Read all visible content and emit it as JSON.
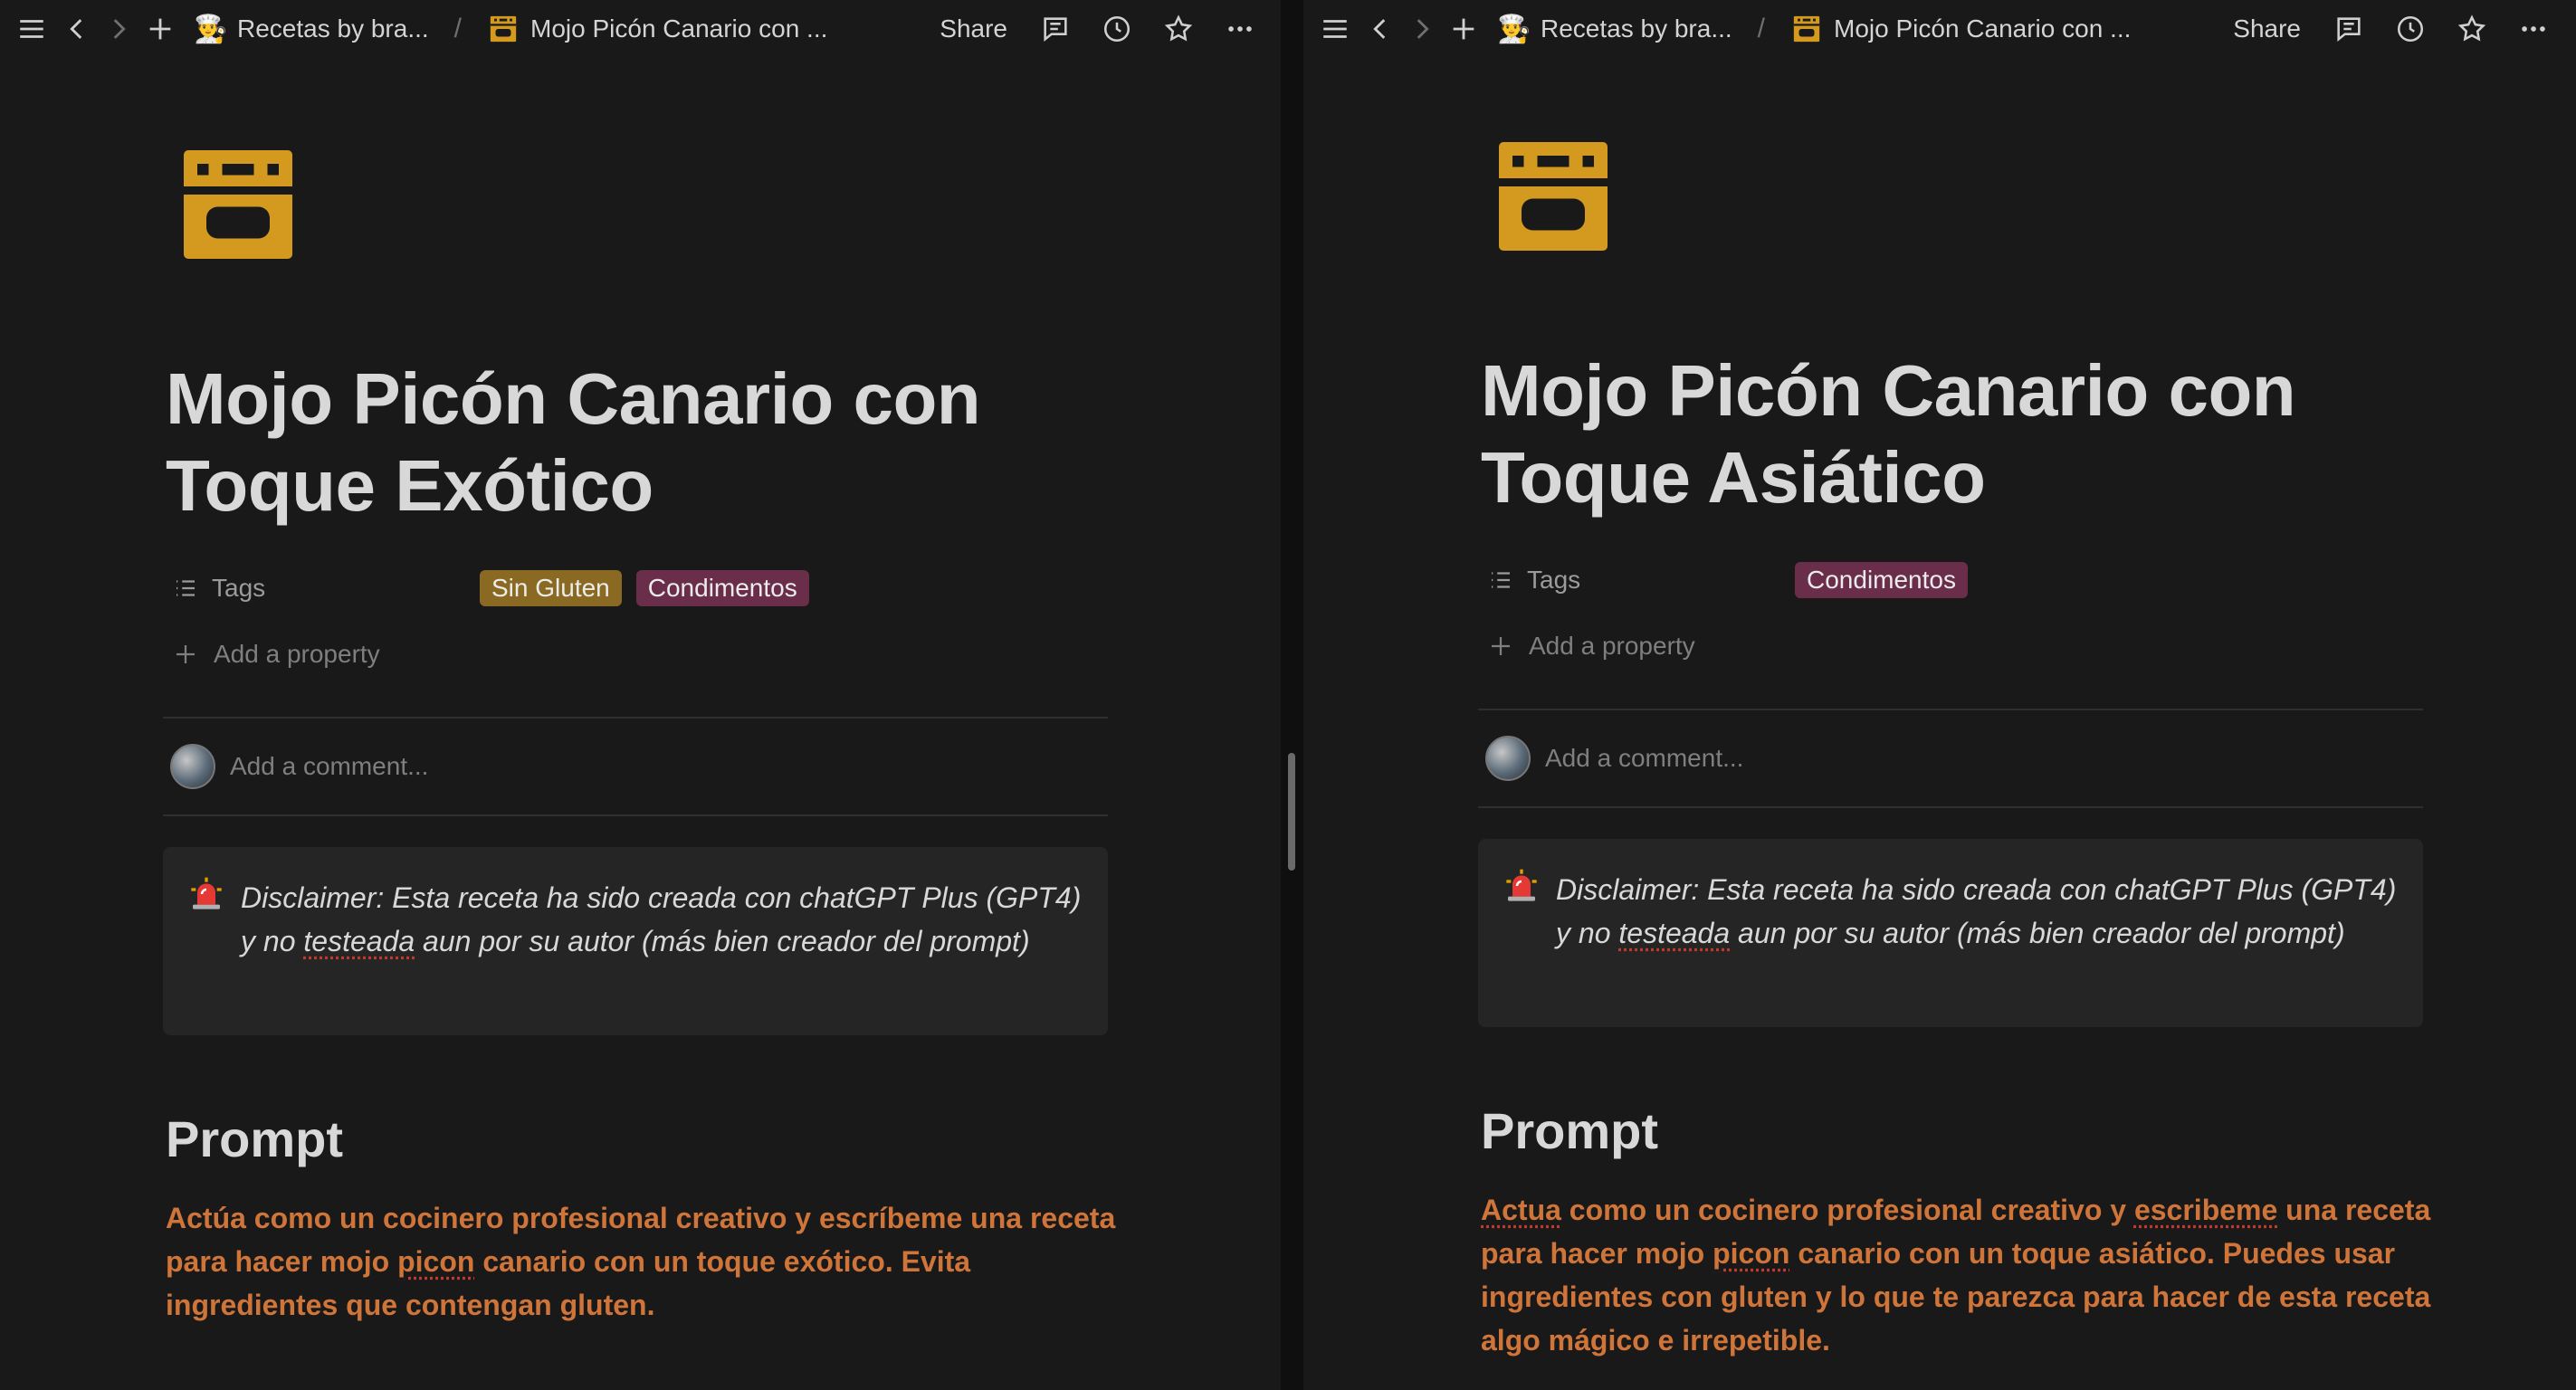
{
  "panes": {
    "left": {
      "breadcrumb": {
        "workspace_emoji": "👨‍🍳",
        "workspace": "Recetas by bra...",
        "page": "Mojo Picón Canario con ..."
      },
      "share": "Share",
      "title_line1": "Mojo Picón Canario con",
      "title_line2": "Toque Exótico",
      "property_name": "Tags",
      "tags": [
        "Sin Gluten",
        "Condimentos"
      ],
      "add_property": "Add a property",
      "comment_placeholder": "Add a comment...",
      "callout": {
        "emoji": "🚨",
        "pre": "Disclaimer: Esta receta ha sido creada con chatGPT Plus (GPT4) y no ",
        "u1": "testeada",
        "post": " aun por su autor (más bien creador del prompt)"
      },
      "heading": "Prompt",
      "prompt": {
        "p1": "Actúa como un cocinero profesional creativo y escríbeme una receta para hacer mojo ",
        "u1": "picon",
        "p2": " canario con un toque exótico. Evita ingredientes que contengan gluten."
      }
    },
    "right": {
      "breadcrumb": {
        "workspace_emoji": "👨‍🍳",
        "workspace": "Recetas by bra...",
        "page": "Mojo Picón Canario con ..."
      },
      "share": "Share",
      "title_line1": "Mojo Picón Canario con",
      "title_line2": "Toque Asiático",
      "property_name": "Tags",
      "tags": [
        "Condimentos"
      ],
      "add_property": "Add a property",
      "comment_placeholder": "Add a comment...",
      "callout": {
        "emoji": "🚨",
        "pre": "Disclaimer: Esta receta ha sido creada con chatGPT Plus (GPT4) y no ",
        "u1": "testeada",
        "post": " aun por su autor (más bien creador del prompt)"
      },
      "heading": "Prompt",
      "prompt": {
        "u1": "Actua",
        "p1": " como un cocinero profesional creativo y ",
        "u2": "escribeme",
        "p2": " una receta para hacer mojo ",
        "u3": "picon",
        "p3": " canario con un toque asiático. Puedes usar ingredientes con gluten y lo que te parezca para hacer de esta receta algo mágico e irrepetible."
      }
    }
  },
  "colors": {
    "background": "#191919",
    "tag_gold": "#8a6a22",
    "tag_plum": "#6a2e4b",
    "prompt_text": "#d0753a",
    "icon_gold": "#d39a1f"
  },
  "icons": [
    "menu-icon",
    "back-icon",
    "forward-icon",
    "new-page-icon",
    "comments-icon",
    "history-icon",
    "favorite-icon",
    "more-icon",
    "oven-icon",
    "list-icon",
    "plus-icon",
    "siren-icon"
  ]
}
